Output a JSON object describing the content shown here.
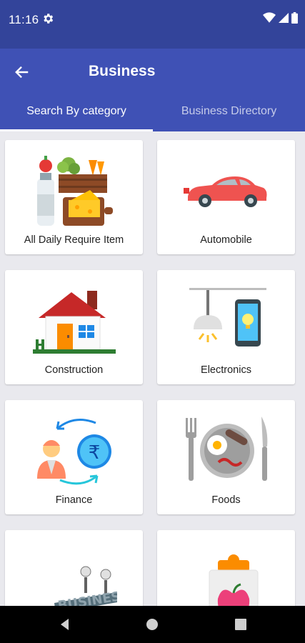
{
  "status": {
    "time": "11:16",
    "icons": [
      "settings-icon",
      "wifi-icon",
      "signal-icon",
      "battery-icon"
    ]
  },
  "appbar": {
    "title": "Business",
    "back_icon": "arrow-left-icon"
  },
  "tabs": [
    {
      "label": "Search By category",
      "active": true
    },
    {
      "label": "Business Directory",
      "active": false
    }
  ],
  "categories": [
    {
      "label": "All Daily Require Item",
      "icon": "groceries-icon"
    },
    {
      "label": "Automobile",
      "icon": "car-icon"
    },
    {
      "label": "Construction",
      "icon": "house-icon"
    },
    {
      "label": "Electronics",
      "icon": "lamp-phone-icon"
    },
    {
      "label": "Finance",
      "icon": "finance-icon"
    },
    {
      "label": "Foods",
      "icon": "plate-icon"
    },
    {
      "label": "",
      "icon": "business-icon"
    },
    {
      "label": "",
      "icon": "health-icon"
    }
  ],
  "colors": {
    "status_bar": "#33449a",
    "app_bar": "#3f51b5",
    "background": "#e9e9ee"
  },
  "navigation": [
    "back-icon",
    "home-icon",
    "recents-icon"
  ]
}
